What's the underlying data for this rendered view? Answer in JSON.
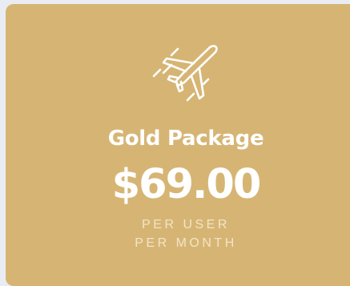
{
  "package": {
    "icon": "airplane-icon",
    "title": "Gold Package",
    "price": "$69.00",
    "period_line1": "PER USER",
    "period_line2": "PER MONTH"
  },
  "colors": {
    "card_background": "#d6b574",
    "text_primary": "#ffffff",
    "text_secondary": "#f3e4c6",
    "page_background": "#e9edf3"
  }
}
